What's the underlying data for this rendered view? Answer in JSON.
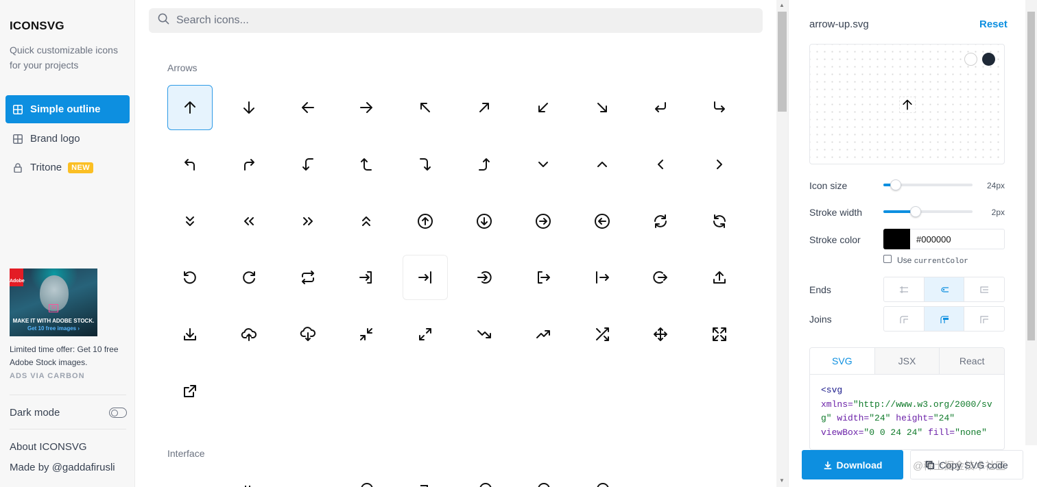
{
  "sidebar": {
    "brand": "ICONSVG",
    "tagline": "Quick customizable icons for your projects",
    "nav": [
      {
        "label": "Simple outline",
        "icon": "grid-icon",
        "active": true
      },
      {
        "label": "Brand logo",
        "icon": "grid-icon",
        "active": false
      },
      {
        "label": "Tritone",
        "icon": "lock-icon",
        "badge": "NEW",
        "active": false
      }
    ],
    "ad": {
      "image_line1": "MAKE IT WITH ADOBE STOCK.",
      "image_line2": "Get 10 free images ›",
      "logo_text": "Adobe",
      "st_text": "St",
      "text": "Limited time offer: Get 10 free Adobe Stock images.",
      "via": "ADS VIA CARBON"
    },
    "dark_mode_label": "Dark mode",
    "about": "About ICONSVG",
    "made_by": "Made by @gaddafirusli"
  },
  "main": {
    "search_placeholder": "Search icons...",
    "sections": [
      {
        "title": "Arrows",
        "icons": [
          "arrow-up",
          "arrow-down",
          "arrow-left",
          "arrow-right",
          "arrow-up-left",
          "arrow-up-right",
          "arrow-down-left",
          "arrow-down-right",
          "return-down-left",
          "corner-down-right",
          "corner-up-left",
          "corner-up-right",
          "corner-left-down",
          "corner-left-up",
          "corner-right-down",
          "corner-right-up",
          "chevron-down",
          "chevron-up",
          "chevron-left",
          "chevron-right",
          "chevrons-down",
          "chevrons-left",
          "chevrons-right",
          "chevrons-up",
          "arrow-up-circle",
          "arrow-down-circle",
          "arrow-right-circle",
          "arrow-left-circle",
          "refresh-cw",
          "refresh-ccw",
          "rotate-ccw",
          "rotate-cw",
          "repeat",
          "log-in",
          "sign-in",
          "arrow-right-circle-open",
          "log-out",
          "sign-out",
          "exit-circle",
          "upload",
          "download",
          "upload-cloud",
          "download-cloud",
          "minimize",
          "maximize",
          "trending-down",
          "trending-up",
          "shuffle",
          "move",
          "expand",
          "external-link"
        ],
        "selected": "arrow-up",
        "hovered": "sign-in"
      },
      {
        "title": "Interface"
      }
    ]
  },
  "panel": {
    "file_name": "arrow-up.svg",
    "reset_label": "Reset",
    "icon_size_label": "Icon size",
    "icon_size_value": "24px",
    "icon_size_fraction": 0.14,
    "stroke_width_label": "Stroke width",
    "stroke_width_value": "2px",
    "stroke_width_fraction": 0.36,
    "stroke_color_label": "Stroke color",
    "stroke_color_value": "#000000",
    "use_current_prefix": "Use",
    "use_current_code": "currentColor",
    "ends_label": "Ends",
    "joins_label": "Joins",
    "ends_selected": 1,
    "joins_selected": 1,
    "tabs": [
      {
        "label": "SVG",
        "active": true
      },
      {
        "label": "JSX",
        "active": false
      },
      {
        "label": "React",
        "active": false
      }
    ],
    "download_label": "Download",
    "copy_label": "Copy SVG code"
  },
  "watermark": "@稀土掘金技术社区",
  "colors": {
    "accent": "#0d8fe0",
    "selected_bg": "#e6f3fd",
    "badge": "#fbbf24"
  }
}
